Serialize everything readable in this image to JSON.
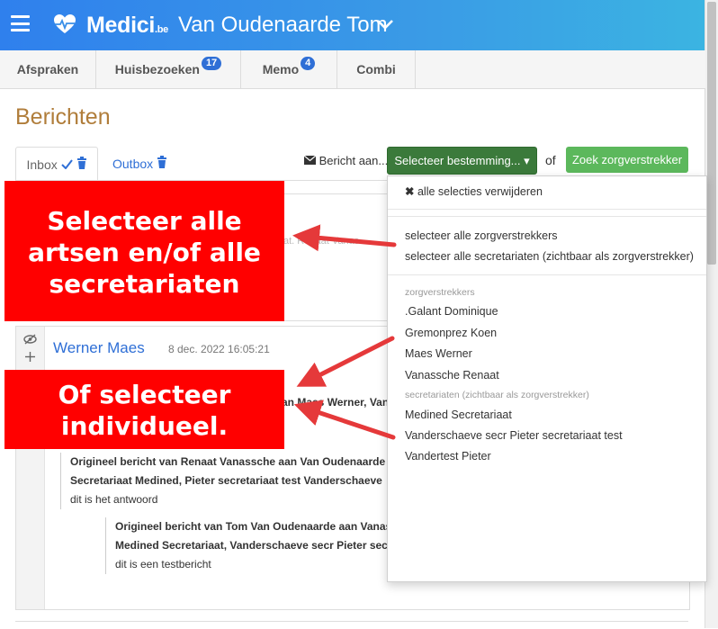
{
  "header": {
    "logo": "Medici",
    "logo_suffix": ".be",
    "user": "Van Oudenaarde Tom"
  },
  "tabs": [
    {
      "label": "Afspraken",
      "badge": ""
    },
    {
      "label": "Huisbezoeken",
      "badge": "17"
    },
    {
      "label": "Memo",
      "badge": "4"
    },
    {
      "label": "Combi",
      "badge": ""
    }
  ],
  "page_title": "Berichten",
  "subtabs": {
    "inbox": "Inbox",
    "outbox": "Outbox"
  },
  "toolbar": {
    "message_to": "Bericht aan...",
    "select_dest": "Selecteer bestemming...",
    "or": "of",
    "search_provider": "Zoek zorgverstrekker"
  },
  "dropdown": {
    "clear": "alle selecties verwijderen",
    "select_all_providers": "selecteer alle zorgverstrekkers",
    "select_all_secretariats": "selecteer alle secretariaten (zichtbaar als zorgverstrekker)",
    "providers_header": "zorgverstrekkers",
    "providers": [
      ".Galant Dominique",
      "Gremonprez Koen",
      "Maes Werner",
      "Vanassche Renaat"
    ],
    "secretariats_header": "secretariaten (zichtbaar als zorgverstrekker)",
    "secretariats": [
      "Medined Secretariaat",
      "Vanderschaeve secr Pieter secretariaat test",
      "Vandertest Pieter"
    ]
  },
  "behind_text": "at. Renaat Vanas",
  "message": {
    "sender": "Werner Maes",
    "timestamp": "8 dec. 2022 16:05:21",
    "recipient_fragment": "an Maes Werner, Vana",
    "quote1_line1": "Origineel bericht van Renaat Vanassche aan Van Oudenaarde T",
    "quote1_line2": "Secretariaat Medined, Pieter secretariaat test Vanderschaeve",
    "quote1_body": "dit is het antwoord",
    "quote2_line1": "Origineel bericht van Tom Van Oudenaarde aan Vanassche",
    "quote2_line2": "Medined Secretariaat, Vanderschaeve secr Pieter secretal",
    "quote2_body": "dit is een testbericht"
  },
  "callouts": {
    "top": [
      "Selecteer alle",
      "artsen en/of alle",
      "secretariaten"
    ],
    "bottom": [
      "Of selecteer",
      "individueel."
    ]
  },
  "colors": {
    "header_start": "#2f80ed",
    "header_end": "#3bb4e2",
    "title": "#b07d3a",
    "link": "#2f6fd6",
    "btn_dest": "#3b7a3b",
    "btn_search": "#5cb85c",
    "callout": "#ff0000",
    "arrow": "#e5393a"
  }
}
